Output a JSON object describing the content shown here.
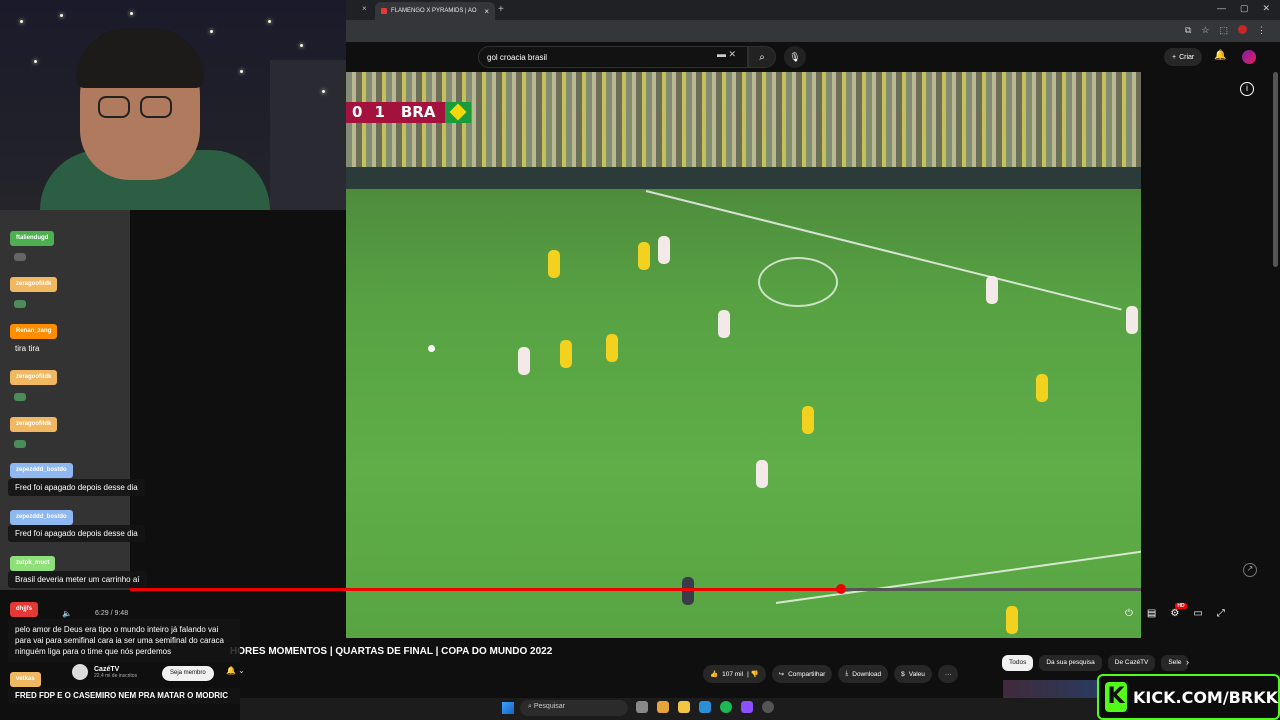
{
  "browser": {
    "tab_title": "FLAMENGO X PYRAMIDS | AO",
    "tab_close": "×",
    "new_tab": "+",
    "window_controls": [
      "—",
      "▢",
      "✕"
    ]
  },
  "youtube": {
    "search_query": "gol croacia brasil",
    "create_label": "Criar",
    "video": {
      "score_home": "0",
      "score_away": "1",
      "team_away": "BRA",
      "time_current": "6:29 / 9:48",
      "progress_fraction": 0.703,
      "title": "HORES MOMENTOS | QUARTAS DE FINAL | COPA DO MUNDO 2022"
    },
    "channel": {
      "name": "CazéTV",
      "subscribers": "22,4 mi de inscritos",
      "member_label": "Seja membro"
    },
    "actions": {
      "likes": "107 mil",
      "share": "Compartilhar",
      "download": "Download",
      "thanks": "Valeu",
      "more": "···"
    },
    "chips": [
      "Todos",
      "Da sua pesquisa",
      "De CazéTV",
      "Sele"
    ],
    "hd_badge": "HD"
  },
  "chat": {
    "messages": [
      {
        "user": "ftaliendugd",
        "text": "",
        "color": "#4caf50"
      },
      {
        "user": "zeragoofildk",
        "text": "",
        "color": "#f0b860"
      },
      {
        "user": "Renan_zang",
        "text": "tira tira",
        "color": "#ff8f00"
      },
      {
        "user": "zeragoofildk",
        "text": "",
        "color": "#f0b860"
      },
      {
        "user": "zeragoofildk",
        "text": "",
        "color": "#f0b860"
      },
      {
        "user": "zepezddd_bostdo",
        "text": "Fred foi apagado depois desse dia",
        "color": "#90b8f0"
      },
      {
        "user": "zepezddd_bostdo",
        "text": "Fred foi apagado depois desse dia",
        "color": "#90b8f0"
      },
      {
        "user": "zutpk_muct",
        "text": "Brasil deveria meter um carrinho aí",
        "color": "#8fe07a"
      },
      {
        "user": "dhjjfs",
        "text": "pelo amor de Deus era tipo o mundo inteiro já falando vai para vai para semifinal cara ia ser uma semifinal do caraca ninguém liga para o time que nós perdemos",
        "color": "#e53935"
      },
      {
        "user": "vetkas",
        "text": "FRED FDP E O CASEMIRO NEM PRA MATAR O MODRIC",
        "color": "#f0b860"
      }
    ]
  },
  "taskbar": {
    "search_placeholder": "Pesquisar"
  },
  "overlay": {
    "kick_logo": "K",
    "kick_text": "KICK.COM/BRKK"
  }
}
